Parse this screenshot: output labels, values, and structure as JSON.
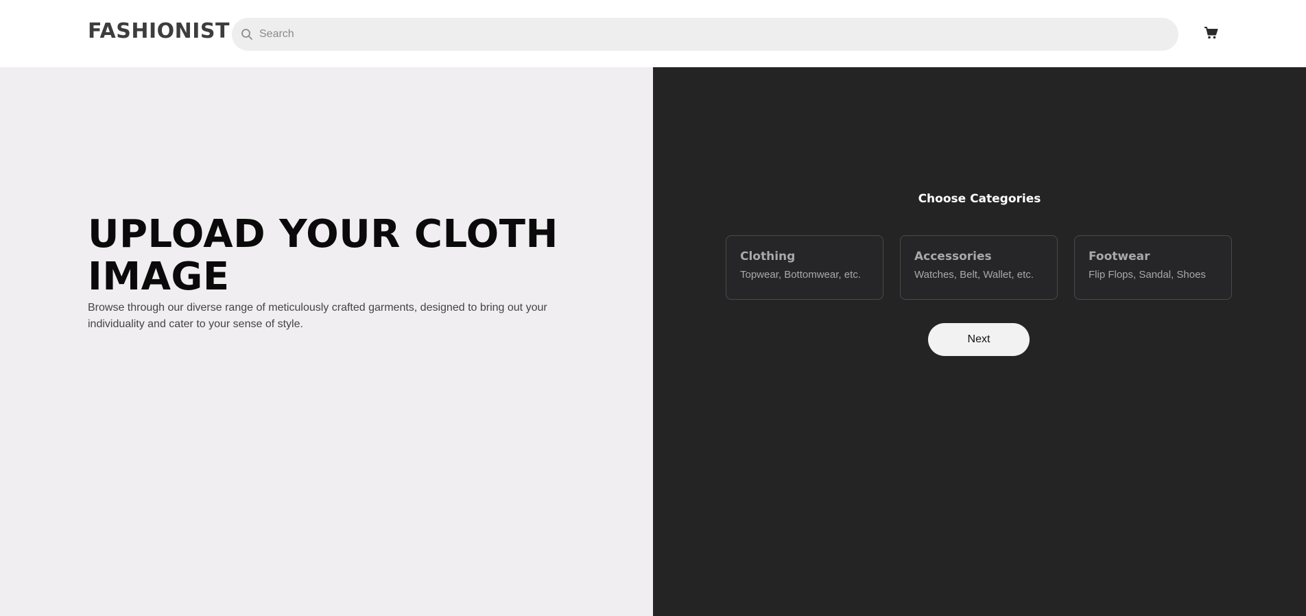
{
  "header": {
    "logo": "FASHIONIST",
    "search_placeholder": "Search",
    "search_icon": "search-icon",
    "cart_icon": "cart-icon"
  },
  "hero": {
    "title": "UPLOAD YOUR CLOTH IMAGE",
    "description": "Browse through our diverse range of meticulously crafted garments, designed to bring out your individuality and cater to your sense of style."
  },
  "categories": {
    "heading": "Choose Categories",
    "items": [
      {
        "title": "Clothing",
        "subtitle": "Topwear, Bottomwear, etc."
      },
      {
        "title": "Accessories",
        "subtitle": "Watches, Belt, Wallet, etc."
      },
      {
        "title": "Footwear",
        "subtitle": "Flip Flops, Sandal, Shoes"
      }
    ],
    "next_label": "Next"
  },
  "colors": {
    "left_panel_bg": "#f0eef0",
    "right_panel_bg": "#242424",
    "search_bg": "#eeeeee",
    "card_border": "#4a4a4a",
    "card_text": "#a9a9ad"
  }
}
